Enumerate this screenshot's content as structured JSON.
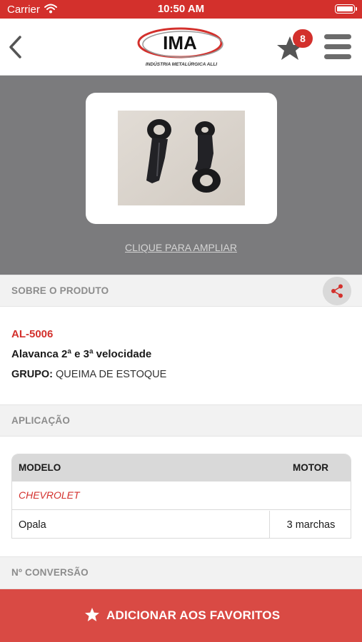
{
  "status_bar": {
    "carrier": "Carrier",
    "time": "10:50 AM"
  },
  "header": {
    "logo_text": "IMA",
    "logo_subtitle": "INDÚSTRIA METALÚRGICA ALLI",
    "favorites_count": "8",
    "icons": [
      "chevron-left-icon",
      "star-icon",
      "hamburger-menu-icon"
    ]
  },
  "hero": {
    "enlarge_link": "CLIQUE PARA AMPLIAR"
  },
  "about": {
    "section_title": "SOBRE O PRODUTO",
    "code": "AL-5006",
    "name": "Alavanca 2ª e 3ª velocidade",
    "group_label": "GRUPO:",
    "group_value": "QUEIMA DE ESTOQUE"
  },
  "application": {
    "section_title": "APLICAÇÃO",
    "columns": [
      "MODELO",
      "MOTOR"
    ],
    "brand": "CHEVROLET",
    "rows": [
      {
        "model": "Opala",
        "motor": "3 marchas"
      }
    ]
  },
  "conversion": {
    "section_title": "Nº CONVERSÃO"
  },
  "footer": {
    "add_favorites": "ADICIONAR AOS FAVORITOS"
  },
  "colors": {
    "brand_red": "#d3302c",
    "footer_red": "#d94a44",
    "hero_gray": "#7b7b7d",
    "section_gray": "#f2f2f2"
  }
}
